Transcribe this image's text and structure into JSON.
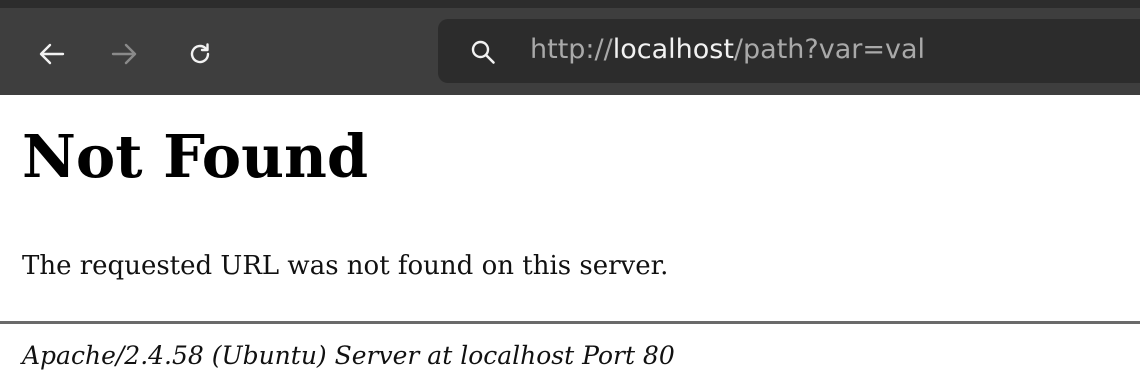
{
  "browser": {
    "nav": {
      "back_icon": "arrow-left-icon",
      "forward_icon": "arrow-right-icon",
      "reload_icon": "reload-icon"
    },
    "urlbar": {
      "search_icon": "search-icon",
      "url_prefix": "http://",
      "url_host": "localhost",
      "url_suffix": "/path?var=val"
    },
    "colors": {
      "toolbar": "#3e3e3e",
      "urlbar": "#2c2c2c",
      "icon_active": "#f2f2f2",
      "icon_disabled": "#8a8a8a"
    }
  },
  "page": {
    "title": "Not Found",
    "message": "The requested URL was not found on this server.",
    "server_signature": "Apache/2.4.58 (Ubuntu) Server at localhost Port 80"
  }
}
